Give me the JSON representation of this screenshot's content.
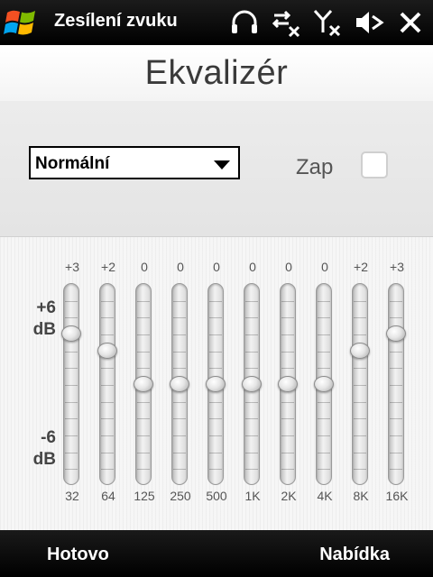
{
  "titlebar": {
    "title": "Zesílení zvuku",
    "icons": [
      "windows-start-icon",
      "headphones-icon",
      "data-sync-icon",
      "signal-off-icon",
      "speaker-mute-icon",
      "close-icon"
    ]
  },
  "page": {
    "title": "Ekvalizér"
  },
  "preset": {
    "selected": "Normální"
  },
  "toggle": {
    "label": "Zap",
    "checked": false
  },
  "scale": {
    "top_value": "+6",
    "top_unit": "dB",
    "bottom_value": "-6",
    "bottom_unit": "dB",
    "max": 6,
    "min": -6
  },
  "bands": [
    {
      "freq": "32",
      "label": "+3",
      "gain": 3
    },
    {
      "freq": "64",
      "label": "+2",
      "gain": 2
    },
    {
      "freq": "125",
      "label": "0",
      "gain": 0
    },
    {
      "freq": "250",
      "label": "0",
      "gain": 0
    },
    {
      "freq": "500",
      "label": "0",
      "gain": 0
    },
    {
      "freq": "1K",
      "label": "0",
      "gain": 0
    },
    {
      "freq": "2K",
      "label": "0",
      "gain": 0
    },
    {
      "freq": "4K",
      "label": "0",
      "gain": 0
    },
    {
      "freq": "8K",
      "label": "+2",
      "gain": 2
    },
    {
      "freq": "16K",
      "label": "+3",
      "gain": 3
    }
  ],
  "softkeys": {
    "left": "Hotovo",
    "right": "Nabídka"
  }
}
